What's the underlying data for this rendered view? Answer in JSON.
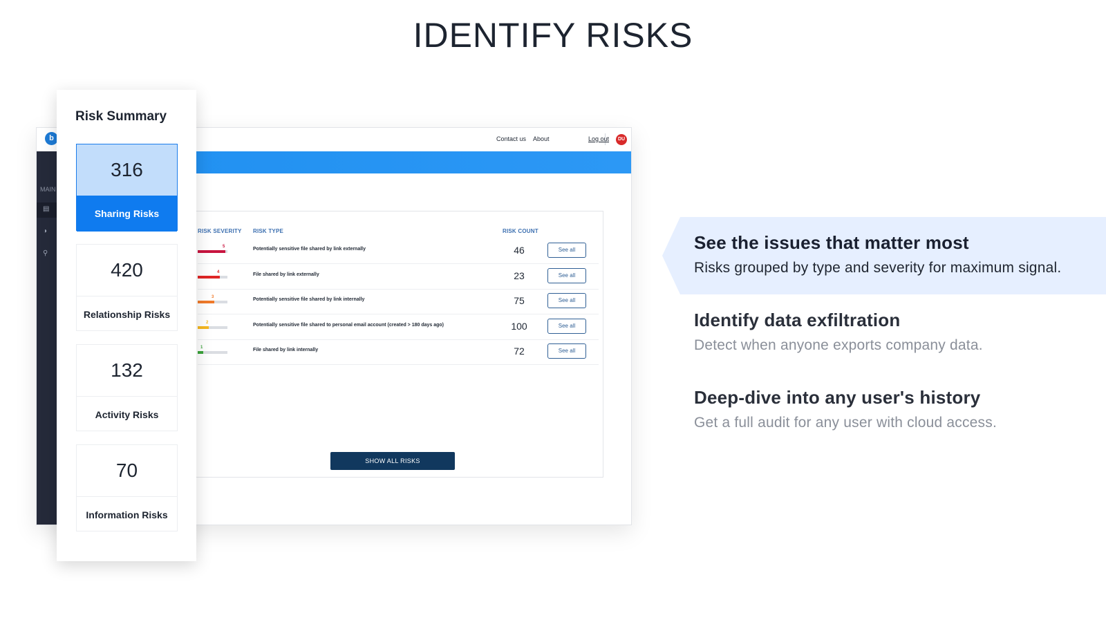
{
  "page": {
    "title": "IDENTIFY RISKS"
  },
  "app": {
    "sidebar": {
      "logo": "b",
      "section_label": "MAIN"
    },
    "topbar": {
      "contact": "Contact us",
      "about": "About",
      "avatar_initials": "DU",
      "logout": "Log out"
    },
    "table": {
      "headers": {
        "severity": "RISK SEVERITY",
        "type": "RISK TYPE",
        "count": "RISK COUNT"
      },
      "rows": [
        {
          "severity": 5,
          "severity_label": "5",
          "color": "#c8153f",
          "type": "Potentially sensitive file shared by link externally",
          "count": "46",
          "action": "See all"
        },
        {
          "severity": 4,
          "severity_label": "4",
          "color": "#e02626",
          "type": "File shared by link externally",
          "count": "23",
          "action": "See all"
        },
        {
          "severity": 3,
          "severity_label": "3",
          "color": "#f07a2a",
          "type": "Potentially sensitive file shared by link internally",
          "count": "75",
          "action": "See all"
        },
        {
          "severity": 2,
          "severity_label": "2",
          "color": "#f5b820",
          "type": "Potentially sensitive file shared to personal email account (created > 180 days ago)",
          "count": "100",
          "action": "See all"
        },
        {
          "severity": 1,
          "severity_label": "1",
          "color": "#3aa33a",
          "type": "File shared by link internally",
          "count": "72",
          "action": "See all"
        }
      ],
      "show_all_label": "SHOW ALL RISKS"
    }
  },
  "summary": {
    "title": "Risk Summary",
    "tiles": [
      {
        "count": "316",
        "label": "Sharing Risks",
        "active": true
      },
      {
        "count": "420",
        "label": "Relationship Risks",
        "active": false
      },
      {
        "count": "132",
        "label": "Activity Risks",
        "active": false
      },
      {
        "count": "70",
        "label": "Information Risks",
        "active": false
      }
    ]
  },
  "features": [
    {
      "title": "See the issues that matter most",
      "desc": "Risks grouped by type and severity for maximum signal.",
      "active": true
    },
    {
      "title": "Identify data exfiltration",
      "desc": "Detect when anyone exports company data.",
      "active": false
    },
    {
      "title": "Deep-dive into any user's history",
      "desc": "Get a full audit for any user with cloud access.",
      "active": false
    }
  ]
}
